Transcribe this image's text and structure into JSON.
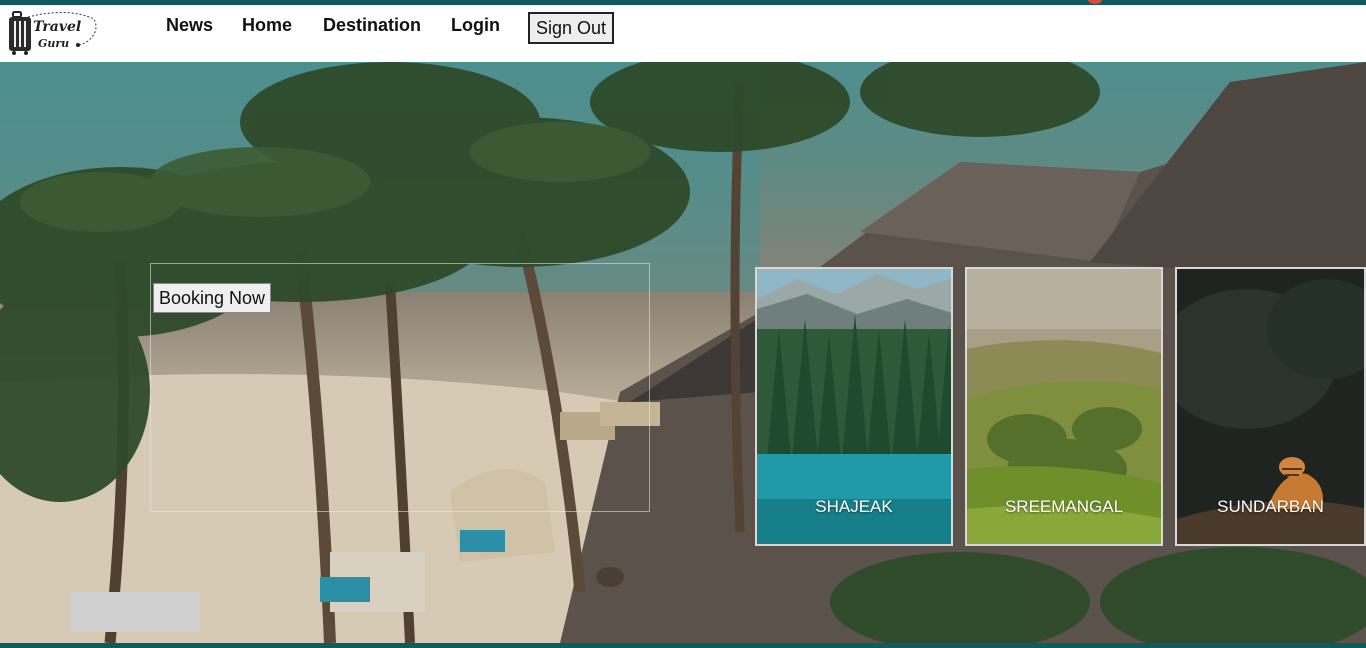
{
  "brand": {
    "line1": "Travel",
    "line2": "Guru",
    "icon": "suitcase-icon"
  },
  "nav": {
    "items": [
      {
        "label": "News"
      },
      {
        "label": "Home"
      },
      {
        "label": "Destination"
      },
      {
        "label": "Login"
      }
    ],
    "sign_out_label": "Sign Out"
  },
  "hero": {
    "booking_label": "Booking Now"
  },
  "destinations": [
    {
      "name": "SHAJEAK"
    },
    {
      "name": "SREEMANGAL"
    },
    {
      "name": "SUNDARBAN"
    }
  ],
  "colors": {
    "accent_stripe": "#0f5a5e",
    "card_border": "#d8d8d8"
  }
}
